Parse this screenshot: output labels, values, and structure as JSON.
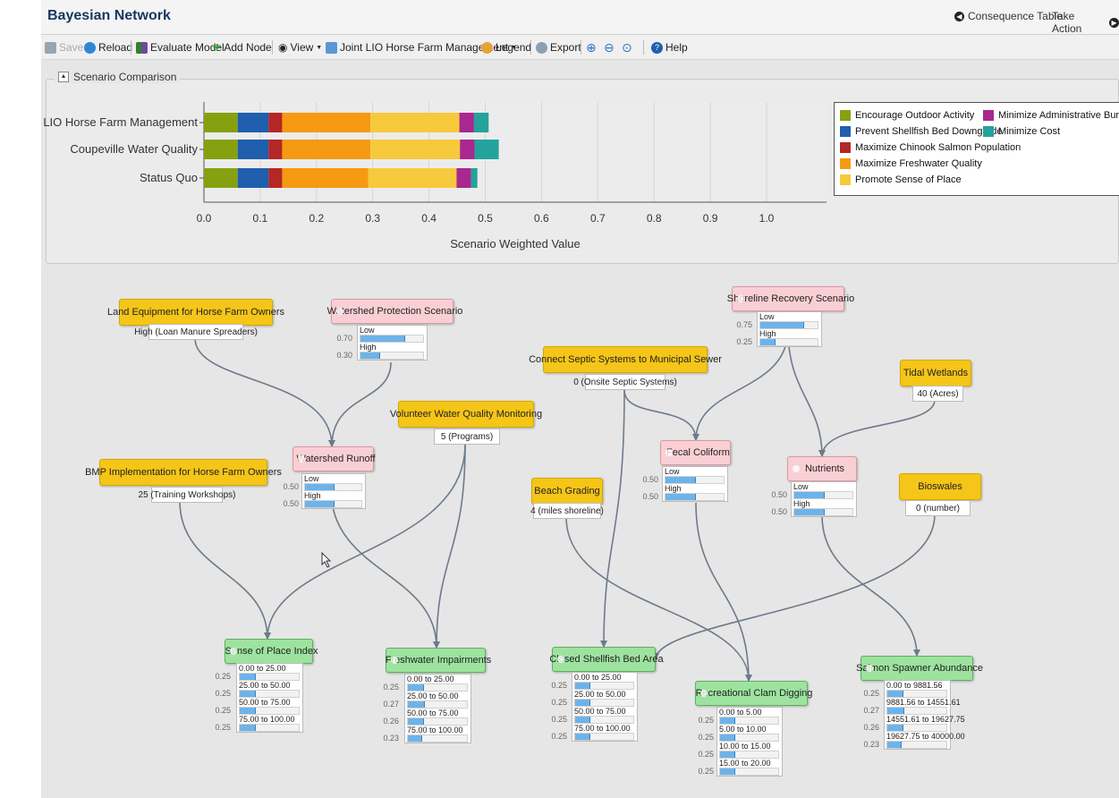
{
  "app": {
    "title": "Bayesian Network",
    "consequence_table": "Consequence Table",
    "take_action": "Take Action"
  },
  "toolbar": {
    "save": "Save",
    "reload": "Reload",
    "evaluate": "Evaluate Model",
    "add_node": "Add Node",
    "view": "View",
    "scenario": "Joint LIO Horse Farm Management",
    "legend": "Legend",
    "export": "Export",
    "help": "Help"
  },
  "panel": {
    "title": "Scenario Comparison"
  },
  "chart_data": {
    "type": "bar",
    "orientation": "horizontal",
    "stacked": true,
    "categories": [
      "Joint LIO Horse Farm Management",
      "Coupeville Water Quality",
      "Status Quo"
    ],
    "series": [
      {
        "name": "Encourage Outdoor Activity",
        "color": "#86a10f",
        "values": [
          0.06,
          0.06,
          0.06
        ]
      },
      {
        "name": "Prevent Shellfish Bed Downgrade",
        "color": "#1f5fae",
        "values": [
          0.055,
          0.055,
          0.055
        ]
      },
      {
        "name": "Maximize Chinook Salmon Population",
        "color": "#b52626",
        "values": [
          0.024,
          0.024,
          0.024
        ]
      },
      {
        "name": "Maximize Freshwater Quality",
        "color": "#f59a12",
        "values": [
          0.157,
          0.157,
          0.153
        ]
      },
      {
        "name": "Promote Sense of Place",
        "color": "#f7c93c",
        "values": [
          0.158,
          0.159,
          0.157
        ]
      },
      {
        "name": "Minimize Administrative Burden",
        "color": "#a8288f",
        "values": [
          0.026,
          0.026,
          0.026
        ]
      },
      {
        "name": "Minimize Cost",
        "color": "#23a39c",
        "values": [
          0.026,
          0.043,
          0.011
        ]
      }
    ],
    "xticks": [
      "0.0",
      "0.1",
      "0.2",
      "0.3",
      "0.4",
      "0.5",
      "0.6",
      "0.7",
      "0.8",
      "0.9",
      "1.0"
    ],
    "xlim": [
      0,
      1.1
    ],
    "xlabel": "Scenario Weighted Value",
    "legend_position": "right",
    "grid": true
  },
  "nodes": {
    "land_equipment": {
      "title": "Land Equipment for Horse Farm Owners",
      "value": "High (Loan Manure Spreaders)"
    },
    "watershed_protection": {
      "title": "Watershed Protection Scenario",
      "states": [
        {
          "label": "Low",
          "prob": "0.70",
          "p": 0.7
        },
        {
          "label": "High",
          "prob": "0.30",
          "p": 0.3
        }
      ]
    },
    "shoreline_recovery": {
      "title": "Shoreline Recovery Scenario",
      "states": [
        {
          "label": "Low",
          "prob": "0.75",
          "p": 0.75
        },
        {
          "label": "High",
          "prob": "0.25",
          "p": 0.25
        }
      ]
    },
    "connect_septic": {
      "title": "Connect Septic Systems to Municipal Sewer",
      "value": "0 (Onsite Septic Systems)"
    },
    "tidal_wetlands": {
      "title": "Tidal Wetlands",
      "value": "40 (Acres)"
    },
    "volunteer_monitoring": {
      "title": "Volunteer Water Quality Monitoring",
      "value": "5 (Programs)"
    },
    "watershed_runoff": {
      "title": "Watershed Runoff",
      "states": [
        {
          "label": "Low",
          "prob": "0.50",
          "p": 0.5
        },
        {
          "label": "High",
          "prob": "0.50",
          "p": 0.5
        }
      ]
    },
    "fecal_coliform": {
      "title": "Fecal Coliform",
      "states": [
        {
          "label": "Low",
          "prob": "0.50",
          "p": 0.5
        },
        {
          "label": "High",
          "prob": "0.50",
          "p": 0.5
        }
      ]
    },
    "nutrients": {
      "title": "Nutrients",
      "states": [
        {
          "label": "Low",
          "prob": "0.50",
          "p": 0.5
        },
        {
          "label": "High",
          "prob": "0.50",
          "p": 0.5
        }
      ]
    },
    "bmp": {
      "title": "BMP Implementation for Horse Farm Owners",
      "value": "25 (Training Workshops)"
    },
    "beach_grading": {
      "title": "Beach Grading",
      "value": "4 (miles shoreline)"
    },
    "bioswales": {
      "title": "Bioswales",
      "value": "0 (number)"
    },
    "sense_of_place": {
      "title": "Sense of Place Index",
      "states": [
        {
          "label": "0.00 to 25.00",
          "prob": "0.25",
          "p": 0.25
        },
        {
          "label": "25.00 to 50.00",
          "prob": "0.25",
          "p": 0.25
        },
        {
          "label": "50.00 to 75.00",
          "prob": "0.25",
          "p": 0.25
        },
        {
          "label": "75.00 to 100.00",
          "prob": "0.25",
          "p": 0.25
        }
      ]
    },
    "freshwater_impairments": {
      "title": "Freshwater Impairments",
      "states": [
        {
          "label": "0.00 to 25.00",
          "prob": "0.25",
          "p": 0.25
        },
        {
          "label": "25.00 to 50.00",
          "prob": "0.27",
          "p": 0.27
        },
        {
          "label": "50.00 to 75.00",
          "prob": "0.26",
          "p": 0.26
        },
        {
          "label": "75.00 to 100.00",
          "prob": "0.23",
          "p": 0.23
        }
      ]
    },
    "closed_shellfish": {
      "title": "Closed Shellfish Bed Area",
      "states": [
        {
          "label": "0.00 to 25.00",
          "prob": "0.25",
          "p": 0.25
        },
        {
          "label": "25.00 to 50.00",
          "prob": "0.25",
          "p": 0.25
        },
        {
          "label": "50.00 to 75.00",
          "prob": "0.25",
          "p": 0.25
        },
        {
          "label": "75.00 to 100.00",
          "prob": "0.25",
          "p": 0.25
        }
      ]
    },
    "clam_digging": {
      "title": "Recreational Clam Digging",
      "states": [
        {
          "label": "0.00 to 5.00",
          "prob": "0.25",
          "p": 0.25
        },
        {
          "label": "5.00 to 10.00",
          "prob": "0.25",
          "p": 0.25
        },
        {
          "label": "10.00 to 15.00",
          "prob": "0.25",
          "p": 0.25
        },
        {
          "label": "15.00 to 20.00",
          "prob": "0.25",
          "p": 0.25
        }
      ]
    },
    "salmon_spawner": {
      "title": "Salmon Spawner Abundance",
      "states": [
        {
          "label": "0.00 to 9881.56",
          "prob": "0.25",
          "p": 0.25
        },
        {
          "label": "9881.56 to 14551.61",
          "prob": "0.27",
          "p": 0.27
        },
        {
          "label": "14551.61 to 19627.75",
          "prob": "0.26",
          "p": 0.26
        },
        {
          "label": "19627.75 to 40000.00",
          "prob": "0.23",
          "p": 0.23
        }
      ]
    }
  }
}
